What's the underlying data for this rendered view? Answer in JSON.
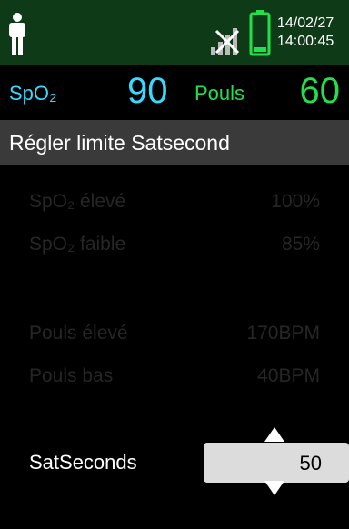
{
  "status_bar": {
    "date": "14/02/27",
    "time": "14:00:45"
  },
  "vitals": {
    "spo2_label": "SpO₂",
    "spo2_value": "90",
    "pulse_label": "Pouls",
    "pulse_value": "60"
  },
  "screen_title": "Régler limite Satsecond",
  "limits": [
    {
      "label": "SpO₂ élevé",
      "value": "100%"
    },
    {
      "label": "SpO₂ faible",
      "value": "85%"
    },
    {
      "label": "Pouls élevé",
      "value": "170BPM"
    },
    {
      "label": "Pouls bas",
      "value": "40BPM"
    }
  ],
  "satseconds": {
    "label": "SatSeconds",
    "value": "50"
  },
  "colors": {
    "spo2": "#38d8ff",
    "pulse": "#22e04a",
    "header_bg": "#0f3a18",
    "title_bg": "#3a3a3a",
    "battery": "#22e04a"
  },
  "icons": [
    "person-icon",
    "no-signal-icon",
    "battery-icon",
    "arrow-up-icon",
    "arrow-down-icon"
  ]
}
